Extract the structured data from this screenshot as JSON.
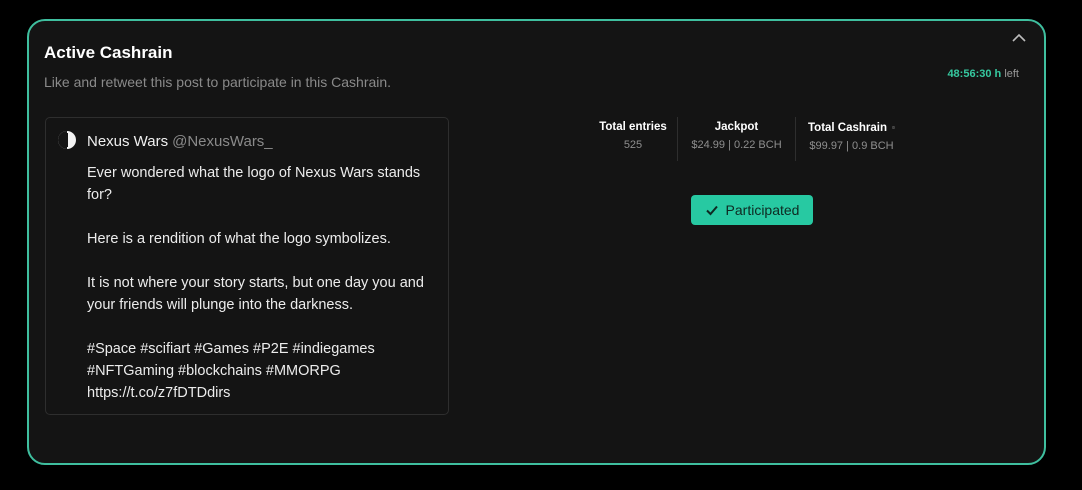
{
  "card": {
    "title": "Active Cashrain",
    "subtitle": "Like and retweet this post to participate in this Cashrain.",
    "timer_value": "48:56:30 h",
    "timer_suffix": "left"
  },
  "tweet": {
    "author": "Nexus Wars",
    "handle": "@NexusWars_",
    "body": "Ever wondered what the logo of Nexus Wars stands for?\n\nHere is a rendition of what the logo symbolizes.\n\nIt is not where your story starts, but one day you and your friends will plunge into the darkness.\n\n#Space #scifiart #Games #P2E #indiegames #NFTGaming #blockchains #MMORPG https://t.co/z7fDTDdirs"
  },
  "stats": [
    {
      "label": "Total entries",
      "value": "525"
    },
    {
      "label": "Jackpot",
      "value": "$24.99 | 0.22 BCH"
    },
    {
      "label": "Total Cashrain",
      "value": "$99.97 | 0.9 BCH"
    }
  ],
  "participated_label": "Participated",
  "icons": {
    "collapse": "chevron-up-icon",
    "info": "info-icon",
    "check": "checkmark-icon",
    "logo": "nexus-wars-logo"
  },
  "colors": {
    "accent": "#27c9a2",
    "border": "#3fbf9f",
    "timer": "#36c9a0"
  }
}
